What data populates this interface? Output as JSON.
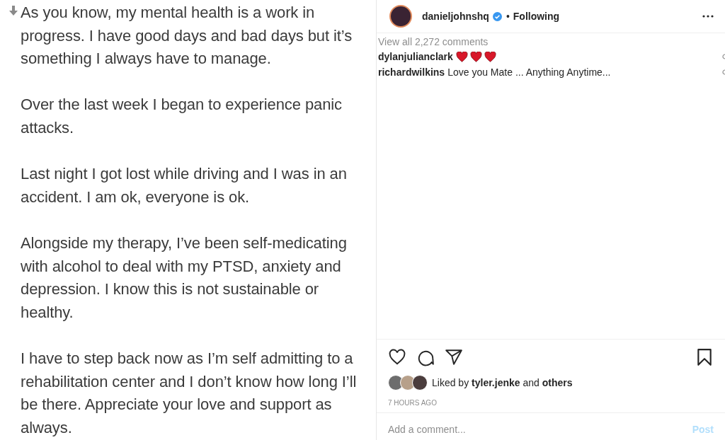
{
  "post_text": {
    "paragraphs": [
      "As you know, my mental health is a work in progress. I have good days and bad days but it’s something I always have to manage.",
      "Over the last week I began to experience panic attacks.",
      "Last night I got lost while driving and I was in an accident. I am ok, everyone is ok.",
      "Alongside my therapy, I’ve been self-medicating with alcohol to deal with my PTSD, anxiety and depression. I know this is not sustainable or healthy.",
      "I have to step back now as I’m self admitting to a rehabilitation center and I don’t know how long I’ll be there. Appreciate your love and support as always."
    ]
  },
  "header": {
    "username": "danieljohnshq",
    "verified": true,
    "separator": "•",
    "follow_status": "Following"
  },
  "comments_link": "View all 2,272 comments",
  "comments": [
    {
      "kind": "hearts",
      "username": "dylanjulianclark"
    },
    {
      "kind": "text",
      "username": "richardwilkins",
      "text": "Love you Mate ... Anything Anytime..."
    }
  ],
  "likes": {
    "text": "Liked by **tyler.jenke** and **others**"
  },
  "timestamp": "7 HOURS AGO",
  "comment_field": {
    "placeholder": "Add a comment...",
    "button": "Post"
  }
}
